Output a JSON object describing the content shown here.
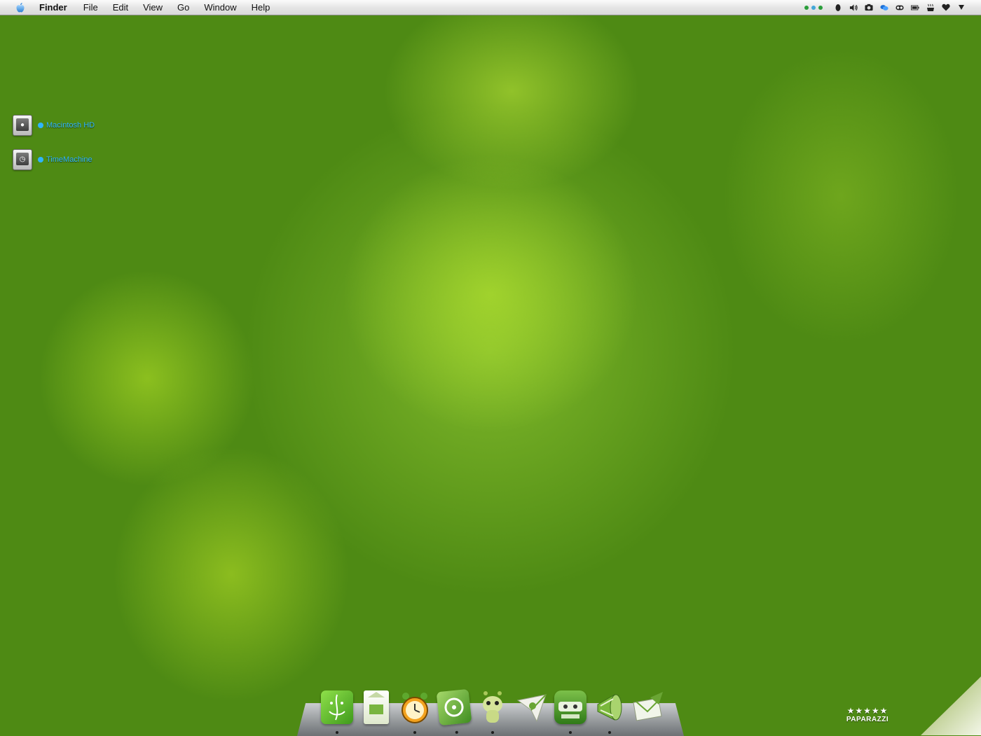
{
  "menubar": {
    "app_name": "Finder",
    "menus": [
      "File",
      "Edit",
      "View",
      "Go",
      "Window",
      "Help"
    ],
    "status_icons": [
      "bluetooth-icon",
      "volume-icon",
      "camera-icon",
      "chat-icon",
      "eyes-icon",
      "battery-icon",
      "coffee-icon",
      "heart-icon",
      "power-icon"
    ]
  },
  "desktop": {
    "icons": [
      {
        "label": "Macintosh HD",
        "icon": "hard-drive-icon"
      },
      {
        "label": "TimeMachine",
        "icon": "time-machine-drive-icon"
      }
    ]
  },
  "dock": {
    "items": [
      {
        "name": "finder",
        "color": "#4fb02a"
      },
      {
        "name": "milk-carton",
        "color": "#e9f2d6"
      },
      {
        "name": "alarm-clock",
        "color": "#f0a020"
      },
      {
        "name": "cd-case",
        "color": "#5ca93a"
      },
      {
        "name": "alien",
        "color": "#c9dd86"
      },
      {
        "name": "paper-plane",
        "color": "#e8e8e0"
      },
      {
        "name": "printer",
        "color": "#4c9a2c"
      },
      {
        "name": "megaphone",
        "color": "#7ab83c"
      },
      {
        "name": "mail",
        "color": "#dde8cf"
      }
    ]
  },
  "widget": {
    "stars": "★★★★★",
    "label": "PAPARAZZI"
  }
}
